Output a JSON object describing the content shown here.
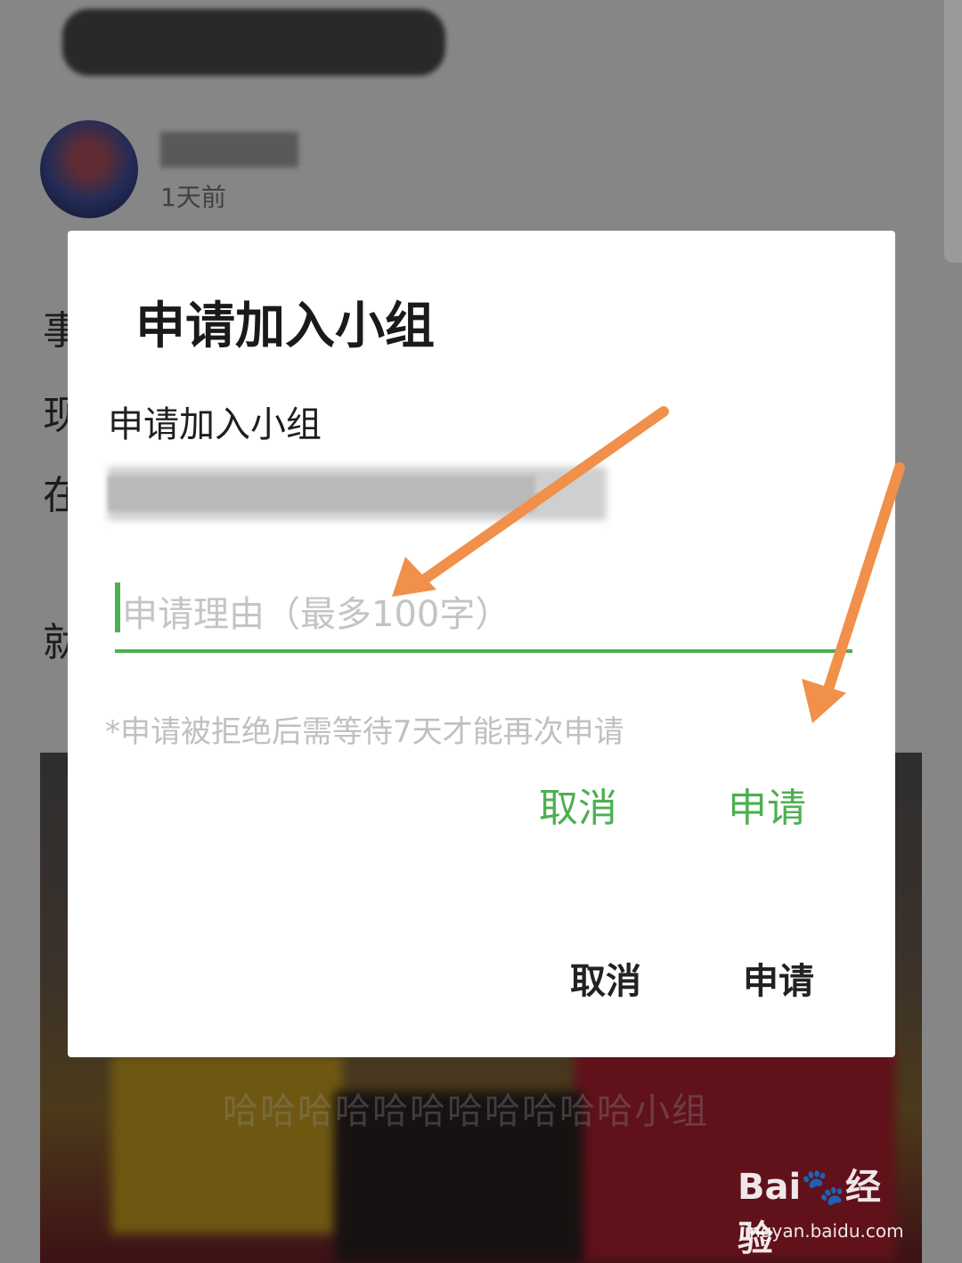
{
  "background": {
    "timestamp": "1天前",
    "left_chars": [
      "事",
      "现",
      "在",
      "就"
    ],
    "right_chars": [
      "...",
      "...",
      "..."
    ],
    "image_caption": "哈哈哈哈哈哈哈哈哈哈哈小组"
  },
  "dialog": {
    "title": "申请加入小组",
    "subtitle": "申请加入小组",
    "reason_placeholder": "申请理由（最多100字）",
    "reason_value": "",
    "hint": "*申请被拒绝后需等待7天才能再次申请",
    "cancel_label": "取消",
    "apply_label": "申请",
    "cancel_label_bottom": "取消",
    "apply_label_bottom": "申请"
  },
  "colors": {
    "accent": "#4cb050",
    "arrow": "#f0904a"
  },
  "watermark": {
    "logo": "Bai🐾经验",
    "url": "jingyan.baidu.com"
  }
}
